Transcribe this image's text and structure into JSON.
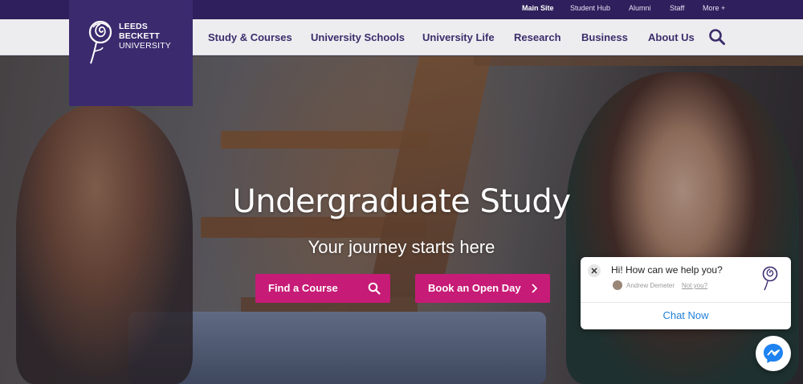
{
  "topbar": {
    "links": [
      "Main Site",
      "Student Hub",
      "Alumni",
      "Staff",
      "More +"
    ]
  },
  "logo": {
    "line1": "LEEDS",
    "line2": "BECKETT",
    "line3": "UNIVERSITY"
  },
  "nav": {
    "items": [
      "Study & Courses",
      "University Schools",
      "University Life",
      "Research",
      "Business",
      "About Us"
    ]
  },
  "hero": {
    "title": "Undergraduate Study",
    "subtitle": "Your journey starts here",
    "find_course": "Find a Course",
    "open_day": "Book an Open Day"
  },
  "chat": {
    "message": "Hi! How can we help you?",
    "agent": "Andrew Demeter",
    "not_you": "Not you?",
    "cta": "Chat Now"
  },
  "colors": {
    "brand_purple": "#3b2a6e",
    "topbar": "#2f1f5c",
    "accent_pink": "#c61b76",
    "chat_link": "#1f7fd6"
  },
  "icons": [
    "rose-logo-icon",
    "search-icon",
    "chevron-right-icon",
    "close-icon",
    "messenger-icon"
  ]
}
